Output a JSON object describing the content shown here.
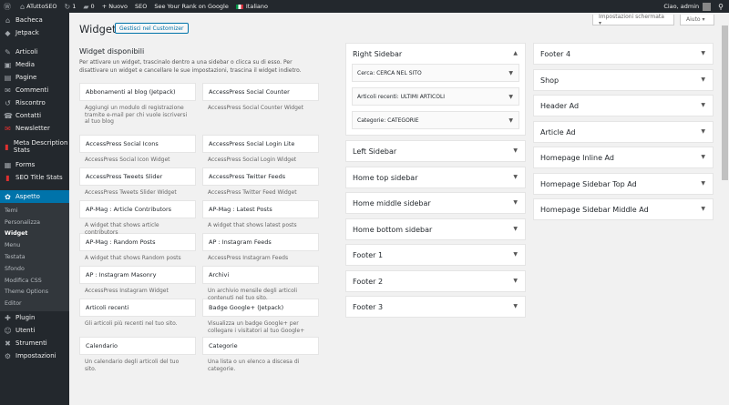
{
  "adminbar": {
    "site_name": "ATuttoSEO",
    "updates": "1",
    "comments": "0",
    "new": "+ Nuovo",
    "seo": "SEO",
    "rank": "See Your Rank on Google",
    "language": "Italiano",
    "greeting": "Ciao, admin"
  },
  "sidebar": {
    "items": [
      {
        "icon": "⌂",
        "label": "Bacheca"
      },
      {
        "icon": "◆",
        "label": "Jetpack"
      },
      {
        "icon": "✎",
        "label": "Articoli"
      },
      {
        "icon": "▣",
        "label": "Media"
      },
      {
        "icon": "▤",
        "label": "Pagine"
      },
      {
        "icon": "✉",
        "label": "Commenti"
      },
      {
        "icon": "↺",
        "label": "Riscontro"
      },
      {
        "icon": "☎",
        "label": "Contatti"
      },
      {
        "icon": "✉",
        "label": "Newsletter"
      },
      {
        "icon": "▮",
        "label": "Meta Description Stats"
      },
      {
        "icon": "▦",
        "label": "Forms"
      },
      {
        "icon": "▮",
        "label": "SEO Title Stats"
      },
      {
        "icon": "✿",
        "label": "Aspetto"
      },
      {
        "icon": "✚",
        "label": "Plugin"
      },
      {
        "icon": "☺",
        "label": "Utenti"
      },
      {
        "icon": "✖",
        "label": "Strumenti"
      },
      {
        "icon": "⚙",
        "label": "Impostazioni"
      }
    ],
    "submenu": [
      "Temi",
      "Personalizza",
      "Widget",
      "Menu",
      "Testata",
      "Sfondo",
      "Modifica CSS",
      "Theme Options",
      "Editor"
    ]
  },
  "screen_options": "Impostazioni schermata ▾",
  "help": "Aiuto ▾",
  "page_title": "Widget",
  "customizer_button": "Gestisci nel Customizer",
  "available": {
    "title": "Widget disponibili",
    "description": "Per attivare un widget, trascinalo dentro a una sidebar o clicca su di esso. Per disattivare un widget e cancellare le sue impostazioni, trascina il widget indietro.",
    "widgets": [
      {
        "name": "Abbonamenti al blog (Jetpack)",
        "desc": "Aggiungi un modulo di registrazione tramite e-mail per chi vuole iscriversi al tuo blog"
      },
      {
        "name": "AccessPress Social Counter",
        "desc": "AccessPress Social Counter Widget"
      },
      {
        "name": "AccessPress Social Icons",
        "desc": "AccessPress Social Icon Widget"
      },
      {
        "name": "AccessPress Social Login Lite",
        "desc": "AccessPress Social Login Widget"
      },
      {
        "name": "AccessPress Tweets Slider",
        "desc": "AccessPress Tweets Slider Widget"
      },
      {
        "name": "AccessPress Twitter Feeds",
        "desc": "AccessPress Twitter Feed Widget"
      },
      {
        "name": "AP-Mag : Article Contributors",
        "desc": "A widget that shows article contributors"
      },
      {
        "name": "AP-Mag : Latest Posts",
        "desc": "A widget that shows latest posts"
      },
      {
        "name": "AP-Mag : Random Posts",
        "desc": "A widget that shows Random posts"
      },
      {
        "name": "AP : Instagram Feeds",
        "desc": "AccessPress Instagram Feeds"
      },
      {
        "name": "AP : Instagram Masonry",
        "desc": "AccessPress Instagram Widget"
      },
      {
        "name": "Archivi",
        "desc": "Un archivio mensile degli articoli contenuti nel tuo sito."
      },
      {
        "name": "Articoli recenti",
        "desc": "Gli articoli più recenti nel tuo sito."
      },
      {
        "name": "Badge Google+ (Jetpack)",
        "desc": "Visualizza un badge Google+ per collegare i visitatori al tuo Google+"
      },
      {
        "name": "Calendario",
        "desc": "Un calendario degli articoli del tuo sito."
      },
      {
        "name": "Categorie",
        "desc": "Una lista o un elenco a discesa di categorie."
      }
    ]
  },
  "areas_mid": [
    {
      "title": "Right Sidebar",
      "open": true,
      "widgets": [
        "Cerca: CERCA NEL SITO",
        "Articoli recenti: ULTIMI ARTICOLI",
        "Categorie: CATEGORIE"
      ]
    },
    {
      "title": "Left Sidebar"
    },
    {
      "title": "Home top sidebar"
    },
    {
      "title": "Home middle sidebar"
    },
    {
      "title": "Home bottom sidebar"
    },
    {
      "title": "Footer 1"
    },
    {
      "title": "Footer 2"
    },
    {
      "title": "Footer 3"
    }
  ],
  "areas_right": [
    {
      "title": "Footer 4"
    },
    {
      "title": "Shop"
    },
    {
      "title": "Header Ad"
    },
    {
      "title": "Article Ad"
    },
    {
      "title": "Homepage Inline Ad"
    },
    {
      "title": "Homepage Sidebar Top Ad"
    },
    {
      "title": "Homepage Sidebar Middle Ad"
    }
  ]
}
